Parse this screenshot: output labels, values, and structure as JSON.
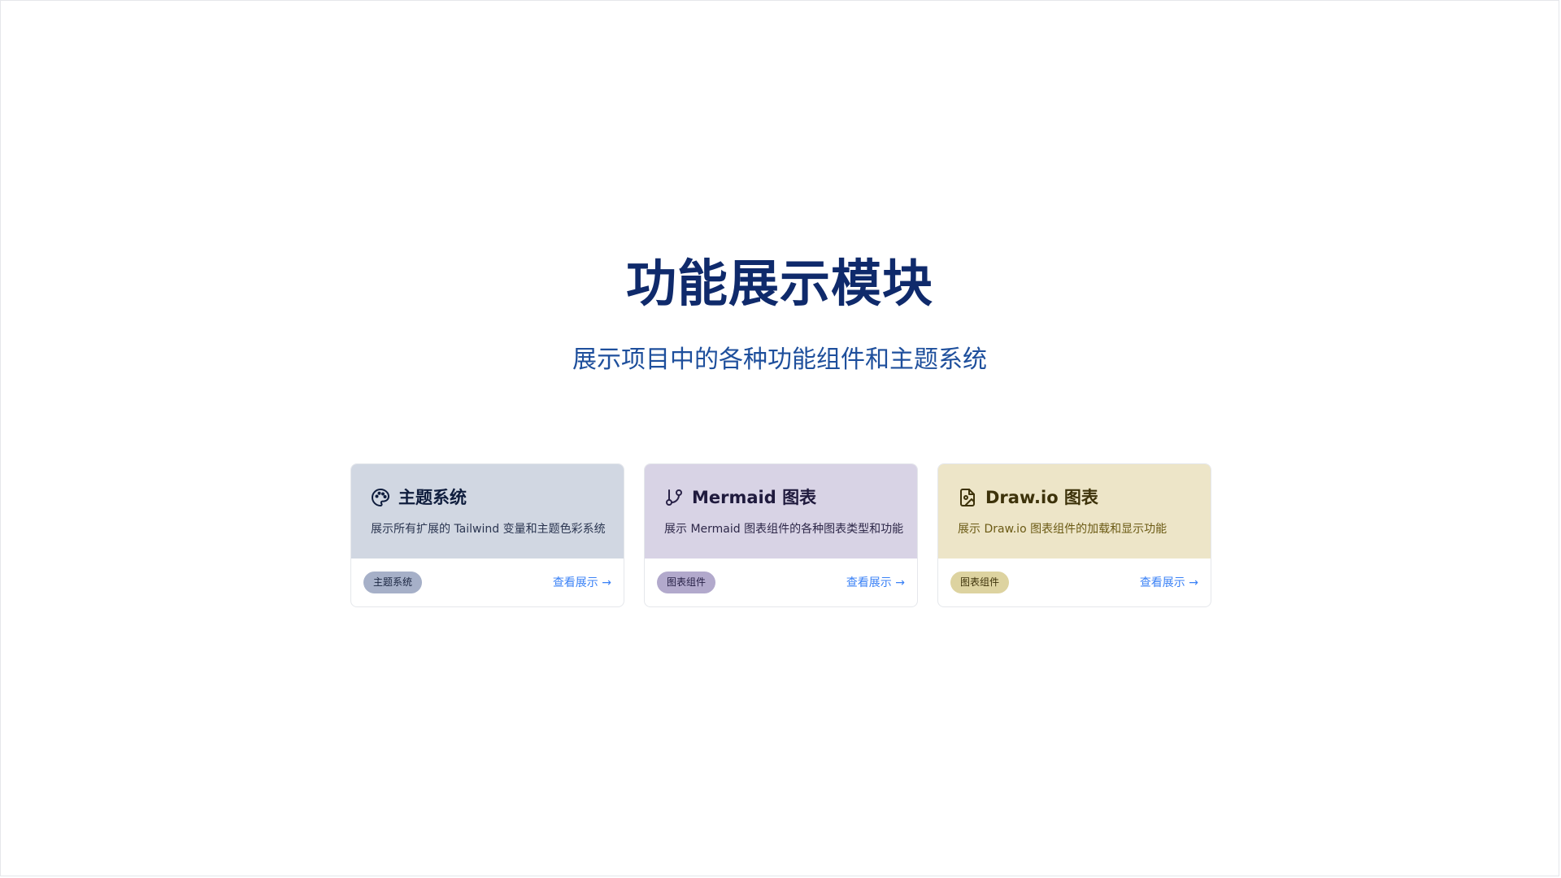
{
  "header": {
    "title": "功能展示模块",
    "subtitle": "展示项目中的各种功能组件和主题系统"
  },
  "cards": [
    {
      "icon": "palette-icon",
      "title": "主题系统",
      "description": "展示所有扩展的 Tailwind 变量和主题色彩系统",
      "tag": "主题系统",
      "link": "查看展示 →"
    },
    {
      "icon": "git-branch-icon",
      "title": "Mermaid 图表",
      "description": "展示 Mermaid 图表组件的各种图表类型和功能",
      "tag": "图表组件",
      "link": "查看展示 →"
    },
    {
      "icon": "file-image-icon",
      "title": "Draw.io 图表",
      "description": "展示 Draw.io 图表组件的加载和显示功能",
      "tag": "图表组件",
      "link": "查看展示 →"
    }
  ],
  "colors": {
    "title": "#0f2a6b",
    "subtitle": "#1e4f9c",
    "link": "#3b82f6",
    "theme_header": "#d1d7e2",
    "mermaid_header": "#d8d3e5",
    "drawio_header": "#ede5c8"
  }
}
